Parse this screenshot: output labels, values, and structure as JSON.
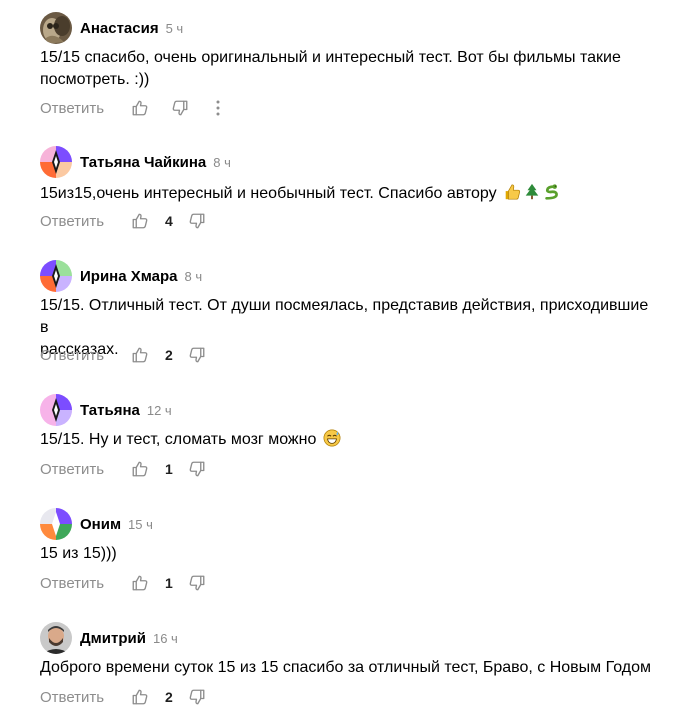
{
  "ui": {
    "reply_label": "Ответить"
  },
  "comments": [
    {
      "author": "Анастасия",
      "time": "5 ч",
      "text_lines": [
        "15/15 спасибо, очень оригинальный и интересный тест. Вот бы фильмы такие",
        "посмотреть. :))"
      ],
      "likes": "",
      "avatar": "photo-owl"
    },
    {
      "author": "Татьяна Чайкина",
      "time": "8 ч",
      "text_lines": [
        "15из15,очень интересный и необычный тест. Спасибо автору"
      ],
      "emojis": [
        "thumbs-up-emoji",
        "christmas-tree-emoji",
        "snake-emoji"
      ],
      "likes": "4",
      "avatar": "pattern-purple-orange"
    },
    {
      "author": "Ирина Хмара",
      "time": "8 ч",
      "text_lines": [
        "15/15. Отличный тест. От души посмеялась, представив действия, присходившие в",
        "рассказах."
      ],
      "likes": "2",
      "avatar": "pattern-green-orange"
    },
    {
      "author": "Татьяна",
      "time": "12 ч",
      "text_lines": [
        "15/15. Ну и тест, сломать мозг можно"
      ],
      "emojis": [
        "grinning-sweat-emoji"
      ],
      "likes": "1",
      "avatar": "pattern-pink"
    },
    {
      "author": "Оним",
      "time": "15 ч",
      "text_lines": [
        "15 из 15)))"
      ],
      "likes": "1",
      "avatar": "pattern-quadrants"
    },
    {
      "author": "Дмитрий",
      "time": "16 ч",
      "text_lines": [
        "Доброго времени суток 15 из 15 спасибо за отличный тест, Браво, с Новым Годом"
      ],
      "likes": "2",
      "avatar": "photo-man"
    }
  ],
  "colors": {
    "muted": "#8d8d8d",
    "count": "#1f1f1f"
  }
}
